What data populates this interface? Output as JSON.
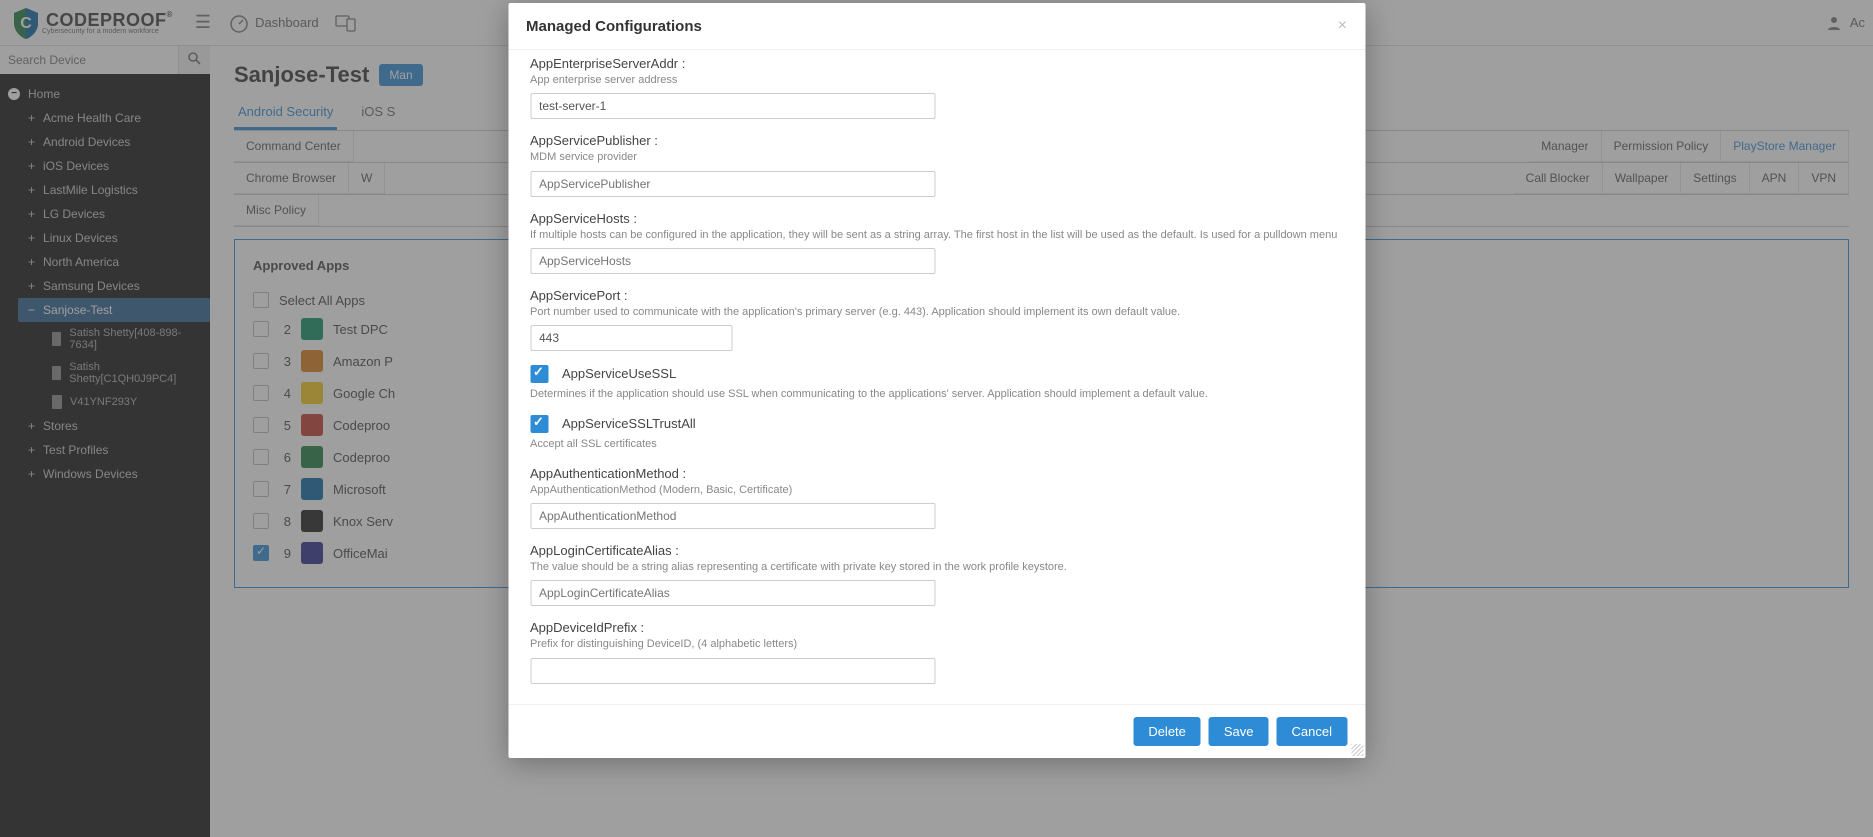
{
  "brand": {
    "name": "CODEPROOF",
    "tagline": "Cybersecurity for a modern workforce"
  },
  "topnav": {
    "dashboard": "Dashboard",
    "account_prefix": "Ac"
  },
  "search_placeholder": "Search Device",
  "sidebar": {
    "home": "Home",
    "items": [
      "Acme Health Care",
      "Android Devices",
      "iOS Devices",
      "LastMile Logistics",
      "LG Devices",
      "Linux Devices",
      "North America",
      "Samsung Devices"
    ],
    "selected": "Sanjose-Test",
    "devices": [
      "Satish Shetty[408-898-7634]",
      "Satish Shetty[C1QH0J9PC4]",
      "V41YNF293Y"
    ],
    "bottom": [
      "Stores",
      "Test Profiles",
      "Windows Devices"
    ]
  },
  "page": {
    "title": "Sanjose-Test",
    "badge": "Man",
    "tabs1": {
      "active": "Android Security",
      "others": [
        "iOS S"
      ]
    },
    "subtabs_row1_left": [
      "Command Center"
    ],
    "subtabs_row1_right_tail": [
      "Manager",
      "Permission Policy",
      "PlayStore Manager"
    ],
    "subtabs_row2_left": [
      "Chrome Browser",
      "W"
    ],
    "subtabs_row2_right_tail": [
      "Call Blocker",
      "Wallpaper",
      "Settings",
      "APN",
      "VPN"
    ],
    "subtabs_row3": [
      "Misc Policy"
    ],
    "subtabs_active": "PlayStore Manager",
    "approved_title": "Approved Apps",
    "select_all": "Select All Apps",
    "apps": [
      {
        "n": "2",
        "label": "Test DPC",
        "color": "#0b8f63"
      },
      {
        "n": "3",
        "label": "Amazon P",
        "color": "#d97a18"
      },
      {
        "n": "4",
        "label": "Google Ch",
        "color": "#f5c518"
      },
      {
        "n": "5",
        "label": "Codeproo",
        "color": "#c0392b"
      },
      {
        "n": "6",
        "label": "Codeproo",
        "color": "#1e7a3e"
      },
      {
        "n": "7",
        "label": "Microsoft",
        "color": "#0a64a4"
      },
      {
        "n": "8",
        "label": "Knox Serv",
        "color": "#1c1c1c"
      },
      {
        "n": "9",
        "label": "OfficeMai",
        "color": "#2b2b8f",
        "checked": true
      }
    ]
  },
  "modal": {
    "title": "Managed Configurations",
    "fields": [
      {
        "key": "AppEnterpriseServerAddr",
        "label": "AppEnterpriseServerAddr :",
        "desc": "App enterprise server address",
        "value": "test-server-1",
        "type": "text"
      },
      {
        "key": "AppServicePublisher",
        "label": "AppServicePublisher :",
        "desc": "MDM service provider",
        "placeholder": "AppServicePublisher",
        "type": "text"
      },
      {
        "key": "AppServiceHosts",
        "label": "AppServiceHosts :",
        "desc": "If multiple hosts can be configured in the application, they will be sent as a string array. The first host in the list will be used as the default. Is used for a pulldown menu",
        "placeholder": "AppServiceHosts",
        "type": "text"
      },
      {
        "key": "AppServicePort",
        "label": "AppServicePort :",
        "desc": "Port number used to communicate with the application's primary server (e.g. 443). Application should implement its own default value.",
        "value": "443",
        "type": "text",
        "narrow": true
      },
      {
        "key": "AppServiceUseSSL",
        "label": "AppServiceUseSSL",
        "desc": "Determines if the application should use SSL when communicating to the applications' server. Application should implement a default value.",
        "type": "check",
        "checked": true
      },
      {
        "key": "AppServiceSSLTrustAll",
        "label": "AppServiceSSLTrustAll",
        "desc": "Accept all SSL certificates",
        "type": "check",
        "checked": true
      },
      {
        "key": "AppAuthenticationMethod",
        "label": "AppAuthenticationMethod :",
        "desc": "AppAuthenticationMethod (Modern, Basic, Certificate)",
        "placeholder": "AppAuthenticationMethod",
        "type": "text"
      },
      {
        "key": "AppLoginCertificateAlias",
        "label": "AppLoginCertificateAlias :",
        "desc": "The value should be a string alias representing a certificate with private key stored in the work profile keystore.",
        "placeholder": "AppLoginCertificateAlias",
        "type": "text"
      },
      {
        "key": "AppDeviceIdPrefix",
        "label": "AppDeviceIdPrefix :",
        "desc": "Prefix for distinguishing DeviceID, (4 alphabetic letters)",
        "type": "text"
      }
    ],
    "buttons": {
      "delete": "Delete",
      "save": "Save",
      "cancel": "Cancel"
    }
  }
}
